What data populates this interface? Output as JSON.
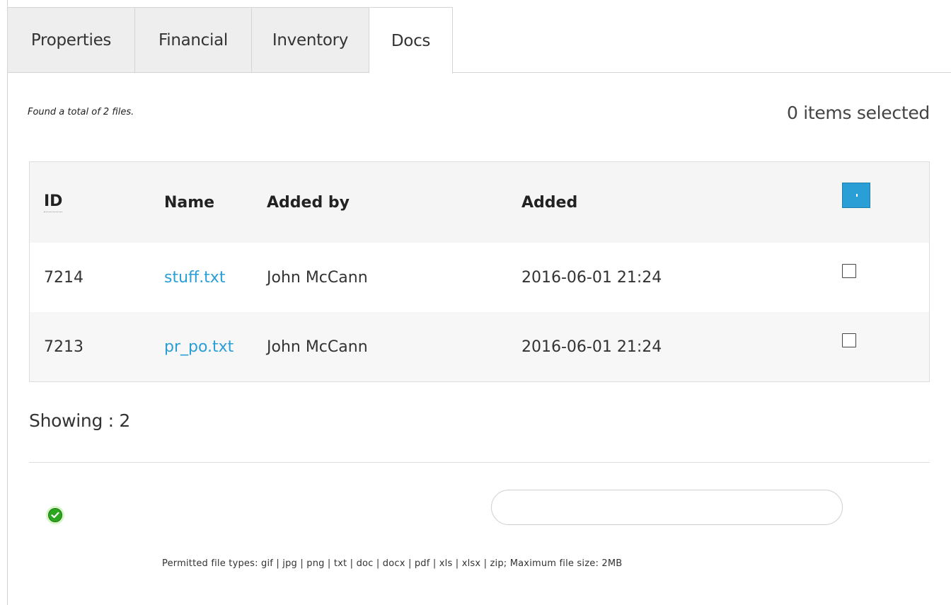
{
  "tabs": [
    {
      "label": "Properties"
    },
    {
      "label": "Financial"
    },
    {
      "label": "Inventory"
    },
    {
      "label": "Docs",
      "active": true
    }
  ],
  "summary": {
    "found_text": "Found a total of 2 files.",
    "selected_text": "0 items selected"
  },
  "table": {
    "headers": {
      "id": "ID",
      "name": "Name",
      "added_by": "Added by",
      "added": "Added"
    },
    "rows": [
      {
        "id": "7214",
        "name": "stuff.txt",
        "added_by": "John McCann",
        "added": "2016-06-01 21:24",
        "checked": false
      },
      {
        "id": "7213",
        "name": "pr_po.txt",
        "added_by": "John McCann",
        "added": "2016-06-01 21:24",
        "checked": false
      }
    ]
  },
  "footer": {
    "showing_text": "Showing : 2",
    "upload_placeholder": "",
    "permitted_text": "Permitted file types: gif | jpg | png | txt | doc | docx | pdf | xls | xlsx | zip; Maximum file size: 2MB"
  },
  "colors": {
    "accent": "#2a9fd6",
    "success": "#2aa71f"
  },
  "icons": {
    "status": "check-circle-icon"
  }
}
